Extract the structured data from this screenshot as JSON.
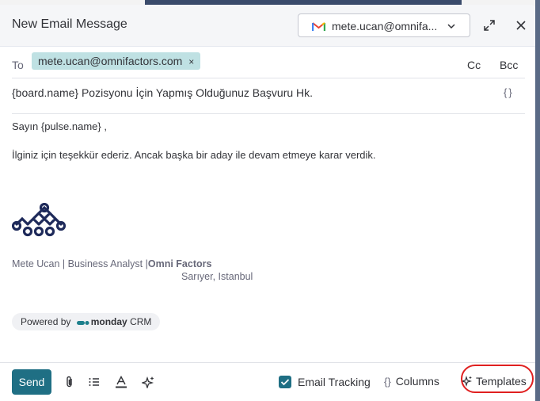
{
  "header": {
    "title": "New Email Message",
    "from_account": "mete.ucan@omnifa...",
    "icons": [
      "gmail-icon",
      "chevron-down-icon",
      "expand-icon",
      "close-icon"
    ]
  },
  "recipients": {
    "to_label": "To",
    "to_chip": "mete.ucan@omnifactors.com",
    "chip_remove": "×",
    "cc_label": "Cc",
    "bcc_label": "Bcc"
  },
  "subject": {
    "value": "{board.name} Pozisyonu İçin Yapmış Olduğunuz Başvuru Hk.",
    "variables_label": "{}"
  },
  "body": {
    "greeting": "Sayın {pulse.name} ,",
    "paragraph": "İlginiz için teşekkür ederiz. Ancak başka bir aday ile devam etmeye karar verdik."
  },
  "signature": {
    "line": "Mete Ucan | Business Analyst |",
    "company": "Omni Factors",
    "location": "Sarıyer, Istanbul"
  },
  "powered_by": {
    "prefix": "Powered by",
    "brand": "monday",
    "suffix": "CRM"
  },
  "footer": {
    "send_label": "Send",
    "tools": [
      "paperclip-icon",
      "list-icon",
      "text-color-icon",
      "ai-sparkle-icon"
    ],
    "email_tracking_label": "Email Tracking",
    "email_tracking_checked": true,
    "columns_braces": "{}",
    "columns_label": "Columns",
    "templates_label": "Templates"
  },
  "colors": {
    "accent": "#1f6f84",
    "chip": "#bfe1e3",
    "highlight_ring": "#e02020",
    "logo": "#1e2a5a"
  }
}
